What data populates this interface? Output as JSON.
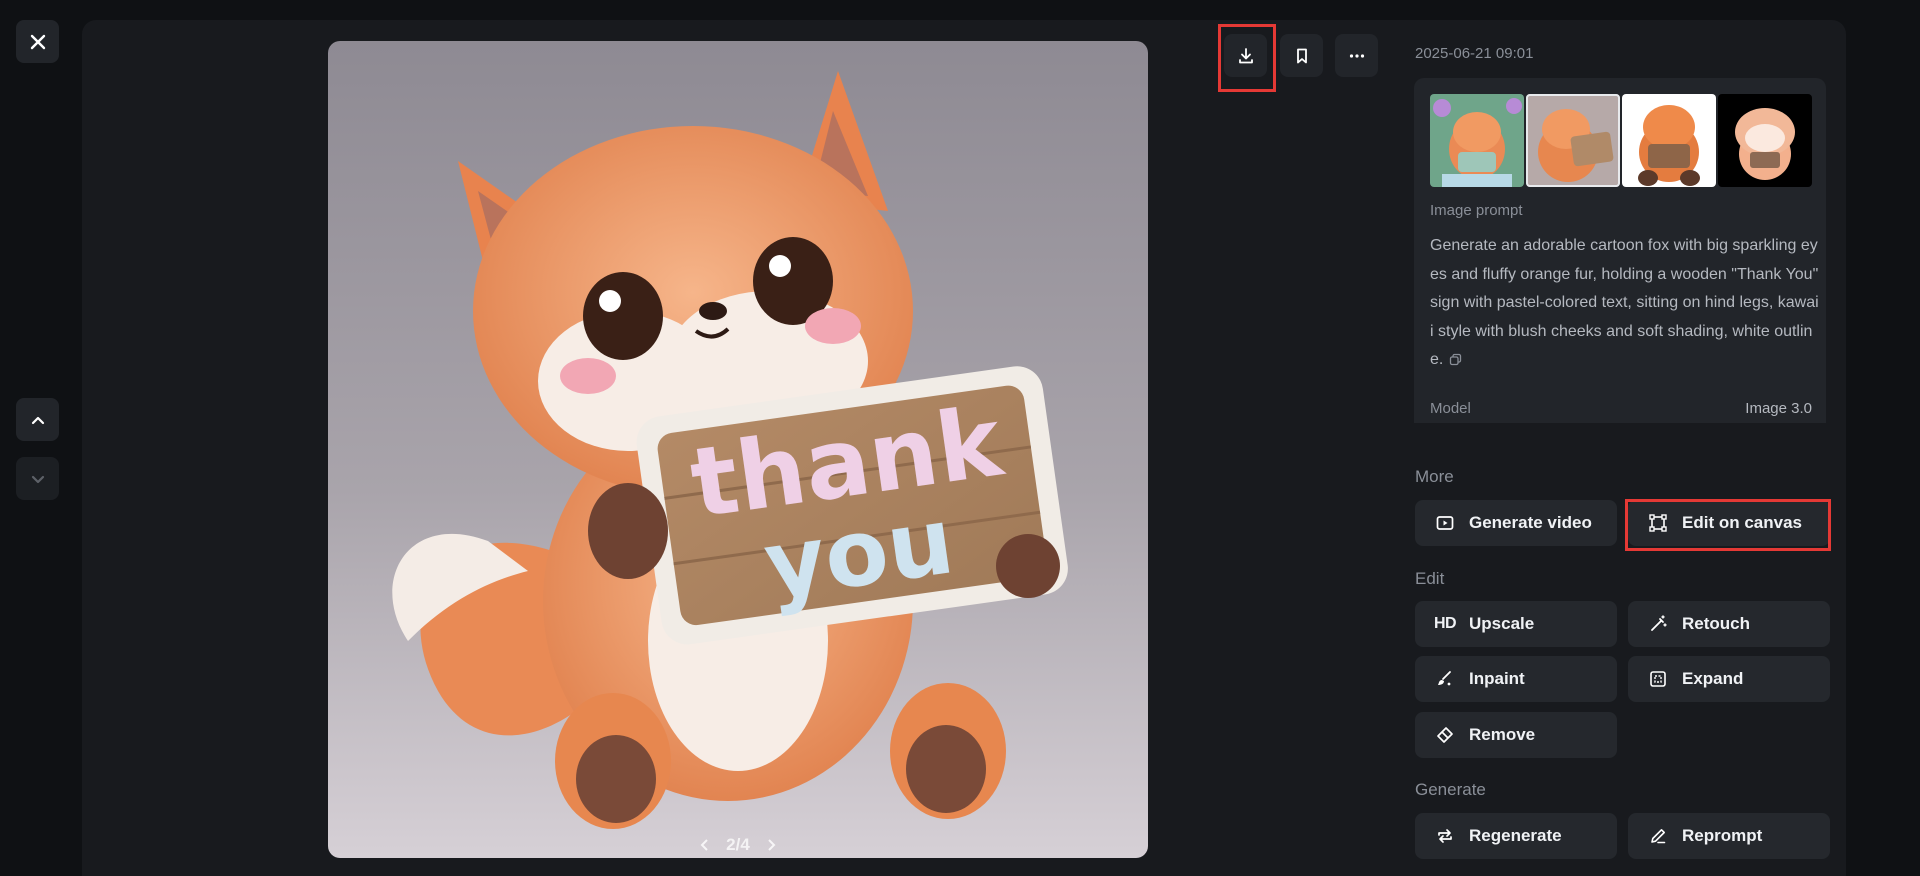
{
  "viewer": {
    "pager": "2/4"
  },
  "sidebar": {
    "timestamp": "2025-06-21 09:01",
    "image_prompt_label": "Image prompt",
    "prompt": "Generate an adorable cartoon fox with big sparkling eyes and fluffy orange fur, holding a wooden \"Thank You\" sign with pastel-colored text, sitting on hind legs, kawaii style with blush cheeks and soft shading, white outline.",
    "model_label": "Model",
    "model_value": "Image 3.0",
    "more_label": "More",
    "edit_label": "Edit",
    "generate_label": "Generate",
    "buttons": {
      "generate_video": "Generate video",
      "edit_on_canvas": "Edit on canvas",
      "upscale": "Upscale",
      "upscale_badge": "HD",
      "retouch": "Retouch",
      "inpaint": "Inpaint",
      "expand": "Expand",
      "remove": "Remove",
      "regenerate": "Regenerate",
      "reprompt": "Reprompt"
    }
  },
  "image_sign_text": [
    "thank",
    "you"
  ],
  "colors": {
    "background": "#0f1114",
    "panel": "#181a1e",
    "button": "#25282d",
    "highlight": "#e53935"
  }
}
